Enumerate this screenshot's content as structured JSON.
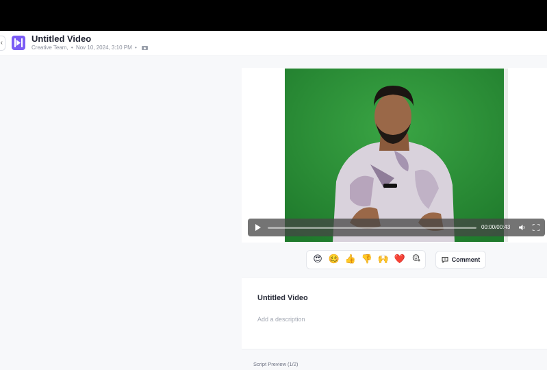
{
  "header": {
    "title": "Untitled Video",
    "team": "Creative Team,",
    "date": "Nov 10, 2024, 3:10 PM",
    "separator": "•"
  },
  "player": {
    "time": "00:00/00:43",
    "progress": 0
  },
  "reactions": [
    {
      "icon": "heart-eyes-emoji",
      "glyph": "😍"
    },
    {
      "icon": "woozy-face-emoji",
      "glyph": "🥴"
    },
    {
      "icon": "thumbs-up-emoji",
      "glyph": "👍"
    },
    {
      "icon": "thumbs-down-emoji",
      "glyph": "👎"
    },
    {
      "icon": "raised-hands-emoji",
      "glyph": "🙌"
    },
    {
      "icon": "red-heart-emoji",
      "glyph": "❤️"
    },
    {
      "icon": "add-reaction-icon",
      "glyph": ""
    }
  ],
  "comment_label": "Comment",
  "details": {
    "title": "Untitled Video",
    "description_placeholder": "Add a description"
  },
  "script_preview": "Script Preview (1/2)",
  "colors": {
    "brand": "#7b5cf5",
    "green_screen": "#2e8e3a"
  }
}
